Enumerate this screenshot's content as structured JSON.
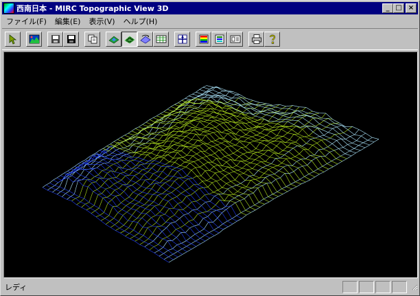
{
  "window": {
    "title": "西南日本 - MIRC Topographic View 3D",
    "controls": {
      "minimize": "_",
      "maximize": "□",
      "close": "×"
    }
  },
  "menu": {
    "items": [
      {
        "label": "ファイル(F)"
      },
      {
        "label": "編集(E)"
      },
      {
        "label": "表示(V)"
      },
      {
        "label": "ヘルプ(H)"
      }
    ]
  },
  "toolbar": {
    "buttons": [
      {
        "icon": "pointer-icon"
      },
      {
        "icon": "landscape-image-icon"
      },
      {
        "icon": "open-file-icon"
      },
      {
        "icon": "save-icon"
      },
      {
        "icon": "copy-icon"
      },
      {
        "icon": "shaded-relief-icon"
      },
      {
        "icon": "wireframe-icon"
      },
      {
        "icon": "rotate-view-icon"
      },
      {
        "icon": "grid-table-icon"
      },
      {
        "icon": "cross-section-icon"
      },
      {
        "icon": "color-scale-icon"
      },
      {
        "icon": "color-legend-icon"
      },
      {
        "icon": "info-panel-icon"
      },
      {
        "icon": "print-icon"
      },
      {
        "icon": "help-icon"
      }
    ],
    "colors": {
      "blue": "#1e3cff",
      "cyan": "#aee8ff",
      "lime": "#b4e61e"
    }
  },
  "status": {
    "text": "レディ"
  }
}
